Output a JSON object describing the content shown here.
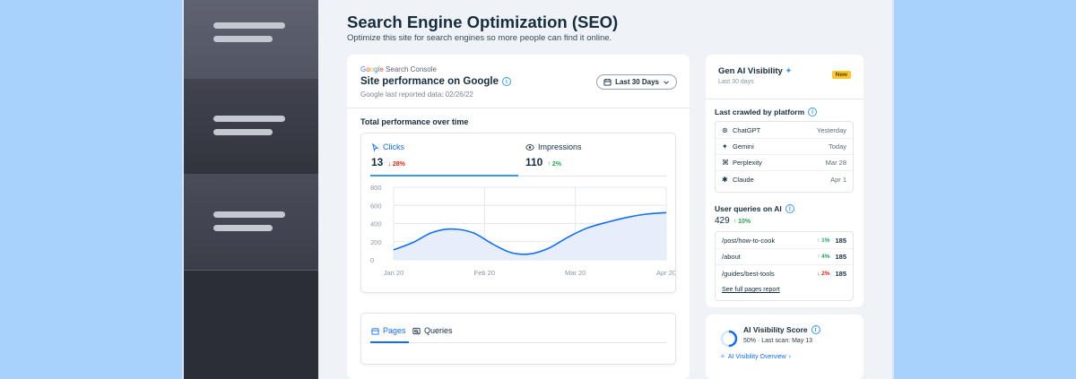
{
  "header": {
    "title": "Search Engine Optimization (SEO)",
    "subtitle": "Optimize this site for search engines so more people can find it online."
  },
  "performance": {
    "provider": "Google Search Console",
    "provider_parts": [
      "G",
      "o",
      "o",
      "g",
      "l",
      "e",
      " Search Console"
    ],
    "title": "Site performance on Google",
    "last_reported": "Google last reported data: 02/26/22",
    "range_label": "Last 30 Days",
    "section_title": "Total performance over time",
    "metrics": [
      {
        "label": "Clicks",
        "value": "13",
        "delta": "28%",
        "direction": "down"
      },
      {
        "label": "Impressions",
        "value": "110",
        "delta": "2%",
        "direction": "up"
      }
    ]
  },
  "chart_data": {
    "type": "area",
    "y_ticks": [
      "800",
      "600",
      "400",
      "200",
      "0"
    ],
    "ylim": [
      0,
      800
    ],
    "x_ticks": [
      "Jan 20",
      "Feb 20",
      "Mar 20",
      "Apr 20"
    ],
    "series": [
      {
        "x": [
          0,
          0.07,
          0.14,
          0.21,
          0.29,
          0.36,
          0.43,
          0.5,
          0.57,
          0.64,
          0.71,
          0.79,
          0.86,
          0.93,
          1.0
        ],
        "values": [
          110,
          190,
          300,
          340,
          300,
          180,
          80,
          65,
          130,
          250,
          350,
          420,
          470,
          505,
          520
        ]
      }
    ],
    "grid": true,
    "color": "#116dff"
  },
  "tabs": [
    {
      "label": "Pages",
      "active": true
    },
    {
      "label": "Queries",
      "active": false
    }
  ],
  "gen_ai": {
    "title": "Gen AI Visibility",
    "subtitle": "Last 30 days",
    "badge": "New",
    "crawled_title": "Last crawled by platform",
    "platforms": [
      {
        "name": "ChatGPT",
        "icon": "chatgpt-icon",
        "glyph": "⊛",
        "when": "Yesterday"
      },
      {
        "name": "Gemini",
        "icon": "gemini-icon",
        "glyph": "✦",
        "when": "Today"
      },
      {
        "name": "Perplexity",
        "icon": "perplexity-icon",
        "glyph": "⌘",
        "when": "Mar 28"
      },
      {
        "name": "Claude",
        "icon": "claude-icon",
        "glyph": "✱",
        "when": "Apr 1"
      }
    ],
    "queries_title": "User queries on AI",
    "queries_total": "429",
    "queries_delta": "10%",
    "queries": [
      {
        "path": "/post/how-to-cook",
        "delta": "1%",
        "direction": "up",
        "value": "185"
      },
      {
        "path": "/about",
        "delta": "4%",
        "direction": "up",
        "value": "185"
      },
      {
        "path": "/guides/best-tools",
        "delta": "2%",
        "direction": "down",
        "value": "185"
      }
    ],
    "see_full": "See full pages report",
    "score_title": "AI Visibility Score",
    "score_percent": "50%",
    "score_value": 0.5,
    "last_scan": "Last scan: May 13",
    "overview_link": "AI Visibility Overview"
  }
}
